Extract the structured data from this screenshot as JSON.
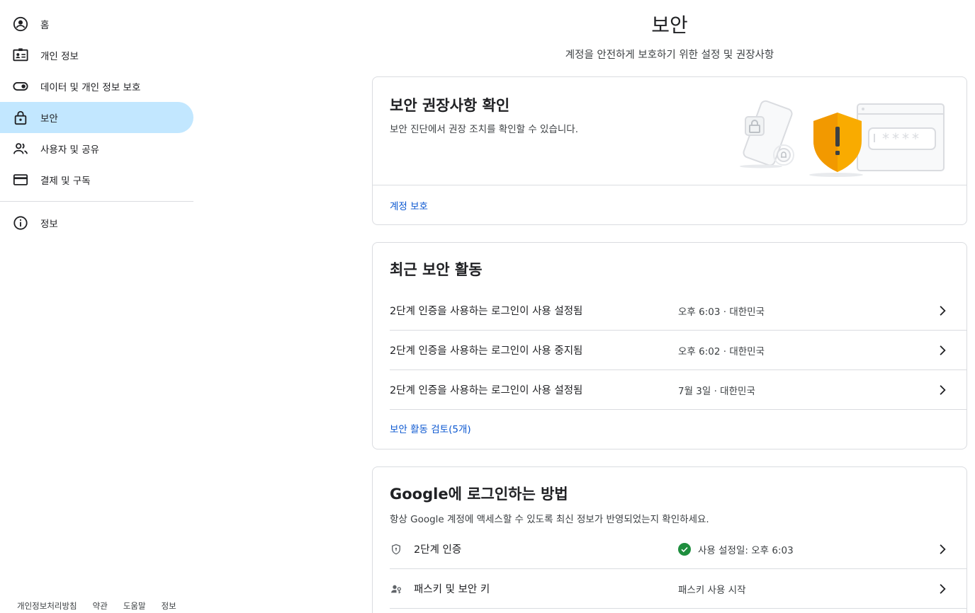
{
  "sidebar": {
    "items": [
      {
        "label": "홈",
        "icon": "account-circle-icon",
        "active": false
      },
      {
        "label": "개인 정보",
        "icon": "id-card-icon",
        "active": false
      },
      {
        "label": "데이터 및 개인 정보 보호",
        "icon": "toggle-icon",
        "active": false
      },
      {
        "label": "보안",
        "icon": "lock-icon",
        "active": true
      },
      {
        "label": "사용자 및 공유",
        "icon": "people-icon",
        "active": false
      },
      {
        "label": "결제 및 구독",
        "icon": "credit-card-icon",
        "active": false
      }
    ],
    "info": {
      "label": "정보",
      "icon": "info-icon"
    }
  },
  "footer": {
    "links": [
      "개인정보처리방침",
      "약관",
      "도움말",
      "정보"
    ]
  },
  "header": {
    "title": "보안",
    "subtitle": "계정을 안전하게 보호하기 위한 설정 및 권장사항"
  },
  "recommendations": {
    "title": "보안 권장사항 확인",
    "description": "보안 진단에서 권장 조치를 확인할 수 있습니다.",
    "link": "계정 보호",
    "password_mask": "****"
  },
  "activity": {
    "title": "최근 보안 활동",
    "rows": [
      {
        "title": "2단계 인증을 사용하는 로그인이 사용 설정됨",
        "meta": "오후 6:03 · 대한민국"
      },
      {
        "title": "2단계 인증을 사용하는 로그인이 사용 중지됨",
        "meta": "오후 6:02 · 대한민국"
      },
      {
        "title": "2단계 인증을 사용하는 로그인이 사용 설정됨",
        "meta": "7월 3일 · 대한민국"
      }
    ],
    "review_link": "보안 활동 검토(5개)"
  },
  "signin": {
    "title": "Google에 로그인하는 방법",
    "description": "항상 Google 계정에 액세스할 수 있도록 최신 정보가 반영되었는지 확인하세요.",
    "rows": [
      {
        "title": "2단계 인증",
        "status": "사용 설정일: 오후 6:03",
        "icon": "shield-icon",
        "verified": true
      },
      {
        "title": "패스키 및 보안 키",
        "status": "패스키 사용 시작",
        "icon": "person-key-icon",
        "verified": false
      }
    ]
  },
  "colors": {
    "active_nav": "#c2e7ff",
    "link": "#0b57d0",
    "shield_orange": "#f9ab00",
    "check_green": "#1e8e3e"
  }
}
